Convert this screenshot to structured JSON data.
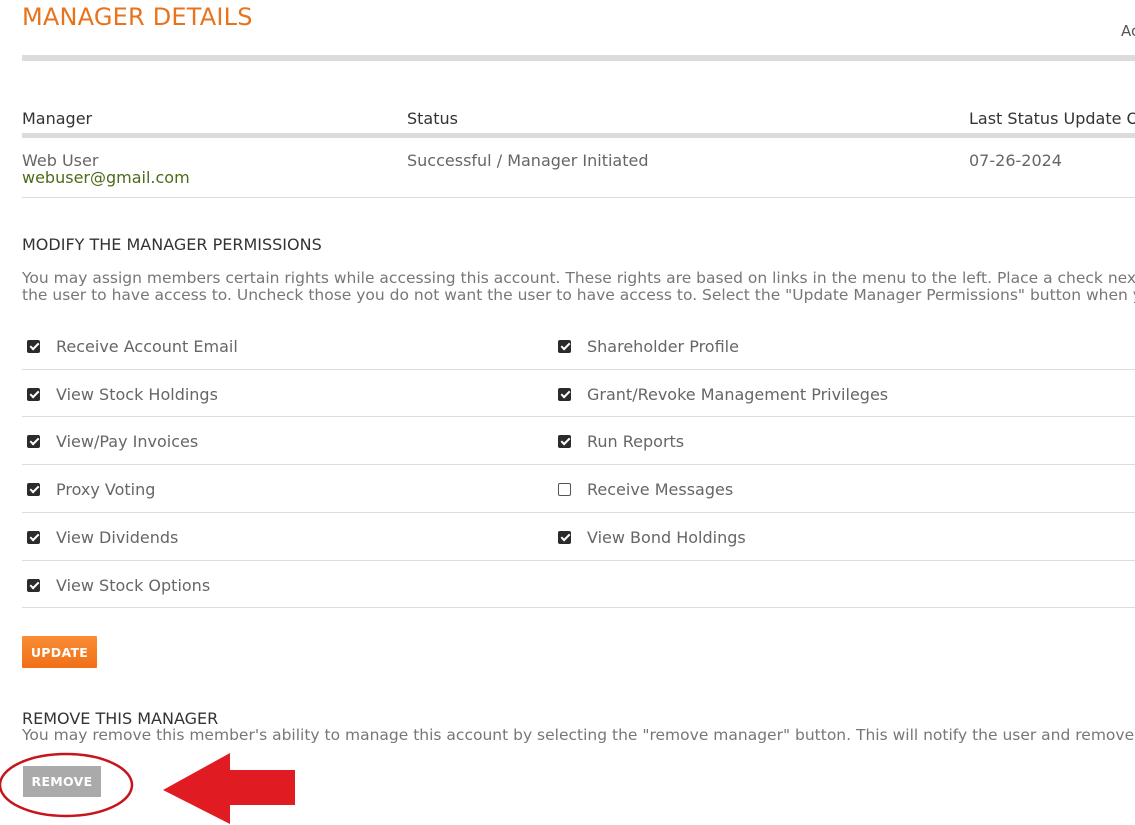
{
  "header": {
    "title": "MANAGER DETAILS",
    "right_cut_text": "Ac"
  },
  "manager_table": {
    "columns": [
      "Manager",
      "Status",
      "Last Status Update On"
    ],
    "row": {
      "name": "Web User",
      "email": "webuser@gmail.com",
      "status": "Successful / Manager Initiated",
      "last_update": "07-26-2024"
    }
  },
  "permissions_section": {
    "title": "MODIFY THE MANAGER PERMISSIONS",
    "description_lines": [
      "You may assign members certain rights while accessing this account. These rights are based on links in the menu to the left. Place a check next to",
      "the user to have access to. Uncheck those you do not want the user to have access to. Select the \"Update Manager Permissions\" button when you"
    ],
    "items": [
      {
        "label": "Receive Account Email",
        "checked": true
      },
      {
        "label": "Shareholder Profile",
        "checked": true
      },
      {
        "label": "View Stock Holdings",
        "checked": true
      },
      {
        "label": "Grant/Revoke Management Privileges",
        "checked": true
      },
      {
        "label": "View/Pay Invoices",
        "checked": true
      },
      {
        "label": "Run Reports",
        "checked": true
      },
      {
        "label": "Proxy Voting",
        "checked": true
      },
      {
        "label": "Receive Messages",
        "checked": false
      },
      {
        "label": "View Dividends",
        "checked": true
      },
      {
        "label": "View Bond Holdings",
        "checked": true
      },
      {
        "label": "View Stock Options",
        "checked": true
      }
    ],
    "update_label": "UPDATE"
  },
  "remove_section": {
    "title": "REMOVE THIS MANAGER",
    "description": "You may remove this member's ability to manage this account by selecting the \"remove manager\" button. This will notify the user and remove the",
    "remove_label": "REMOVE"
  },
  "colors": {
    "accent_orange": "#e8731c",
    "button_orange": "#f47c22",
    "remove_gray": "#aaaaaa",
    "email_green": "#4d6b1a",
    "annotation_red": "#e11b22"
  }
}
